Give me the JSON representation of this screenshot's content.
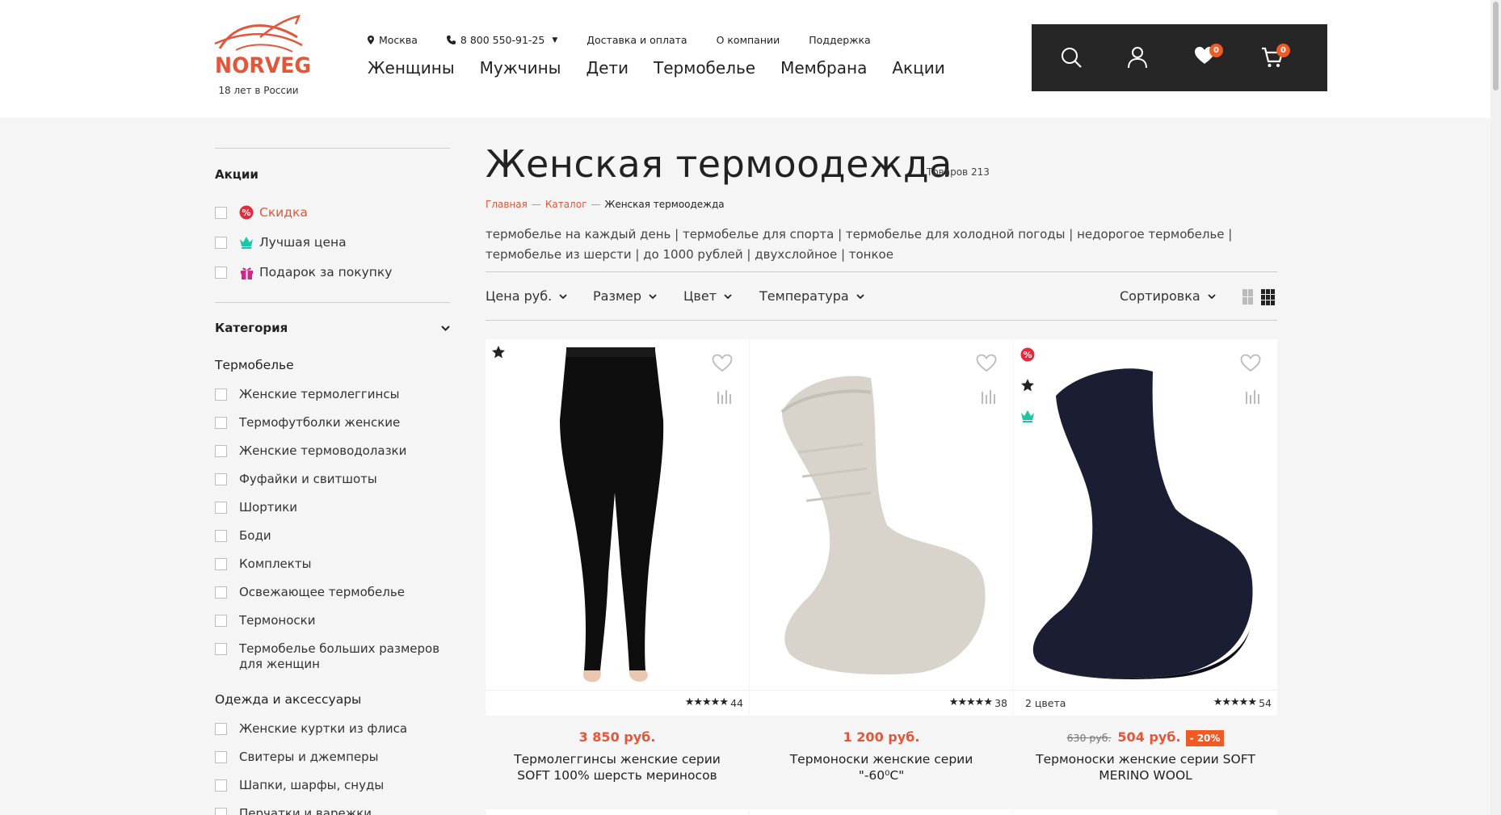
{
  "brand": {
    "logo_text": "NORVEG",
    "tagline": "18 лет в России"
  },
  "topbar": {
    "city": "Москва",
    "phone": "8 800 550-91-25",
    "delivery": "Доставка и оплата",
    "about": "О компании",
    "support": "Поддержка"
  },
  "nav": [
    "Женщины",
    "Мужчины",
    "Дети",
    "Термобелье",
    "Мембрана",
    "Акции"
  ],
  "toolbox": {
    "favorites_count": "0",
    "cart_count": "0"
  },
  "sidebar": {
    "promo_title": "Акции",
    "promos": [
      {
        "label": "Скидка",
        "icon": "discount-icon"
      },
      {
        "label": "Лучшая цена",
        "icon": "crown-icon"
      },
      {
        "label": "Подарок за покупку",
        "icon": "gift-icon"
      }
    ],
    "category_title": "Категория",
    "groups": [
      {
        "title": "Термобелье",
        "items": [
          "Женские термолеггинсы",
          "Термофутболки женские",
          "Женские термоводолазки",
          "Фуфайки и свитшоты",
          "Шортики",
          "Боди",
          "Комплекты",
          "Освежающее термобелье",
          "Термоноски",
          "Термобелье больших размеров для женщин"
        ]
      },
      {
        "title": "Одежда и аксессуары",
        "items": [
          "Женские куртки из флиса",
          "Свитеры и джемперы",
          "Шапки, шарфы, снуды",
          "Перчатки и варежки"
        ]
      }
    ]
  },
  "page": {
    "title": "Женская термоодежда",
    "count": "Товаров 213",
    "breadcrumbs": {
      "home": "Главная",
      "catalog": "Каталог",
      "current": "Женская термоодежда",
      "sep": "—"
    },
    "tags": "термобелье на каждый день | термобелье для спорта | термобелье для холодной погоды | недорогое термобелье | термобелье из шерсти | до 1000 рублей | двухслойное | тонкое",
    "filters": [
      "Цена руб.",
      "Размер",
      "Цвет",
      "Температура"
    ],
    "sort": "Сортировка"
  },
  "products": [
    {
      "name": "Термолеггинсы женские серии SOFT 100% шерсть мериносов",
      "price": "3 850 руб.",
      "rating_count": "44",
      "stars": "★★★★★",
      "colors": "",
      "old_price": "",
      "discount": ""
    },
    {
      "name": "Термоноски женские серии \"-60⁰С\"",
      "price": "1 200 руб.",
      "rating_count": "38",
      "stars": "★★★★★",
      "colors": "",
      "old_price": "",
      "discount": ""
    },
    {
      "name": "Термоноски женские серии SOFT MERINO WOOL",
      "price": "504 руб.",
      "rating_count": "54",
      "stars": "★★★★★",
      "colors": "2 цвета",
      "old_price": "630 руб.",
      "discount": "- 20%"
    }
  ],
  "colors": {
    "accent": "#e2563a",
    "badge": "#f05a24",
    "dark": "#262626",
    "teal": "#1cc6a4",
    "pink": "#d6248d"
  }
}
